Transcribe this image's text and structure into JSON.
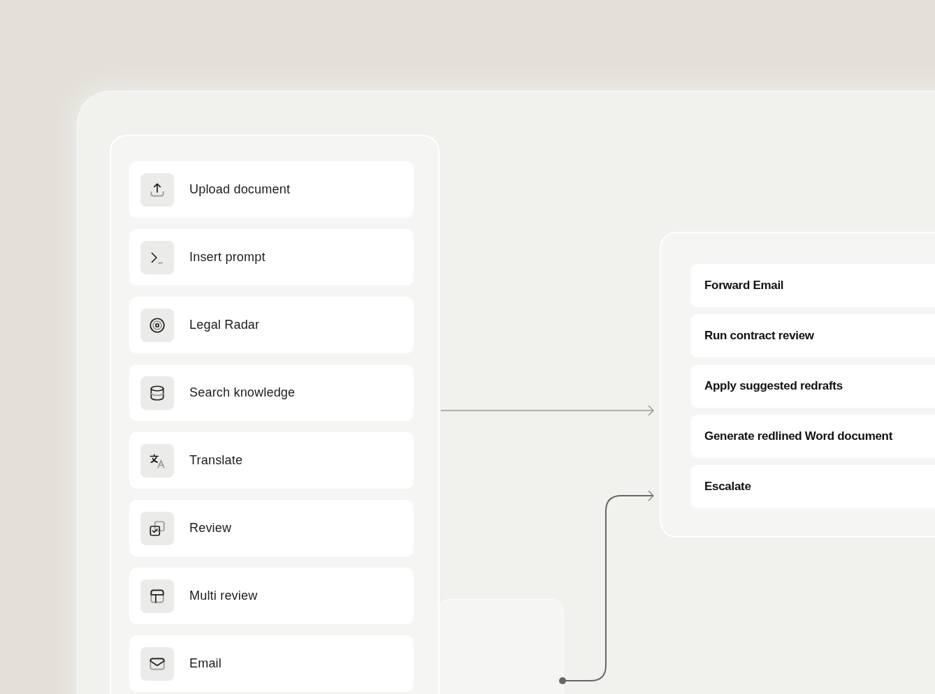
{
  "blocks": [
    {
      "label": "Upload document"
    },
    {
      "label": "Insert prompt"
    },
    {
      "label": "Legal Radar"
    },
    {
      "label": "Search knowledge"
    },
    {
      "label": "Translate"
    },
    {
      "label": "Review"
    },
    {
      "label": "Multi review"
    },
    {
      "label": "Email"
    }
  ],
  "actions": [
    {
      "label": "Forward Email"
    },
    {
      "label": "Run contract review"
    },
    {
      "label": "Apply suggested redrafts"
    },
    {
      "label": "Generate redlined Word document"
    },
    {
      "label": "Escalate"
    }
  ]
}
